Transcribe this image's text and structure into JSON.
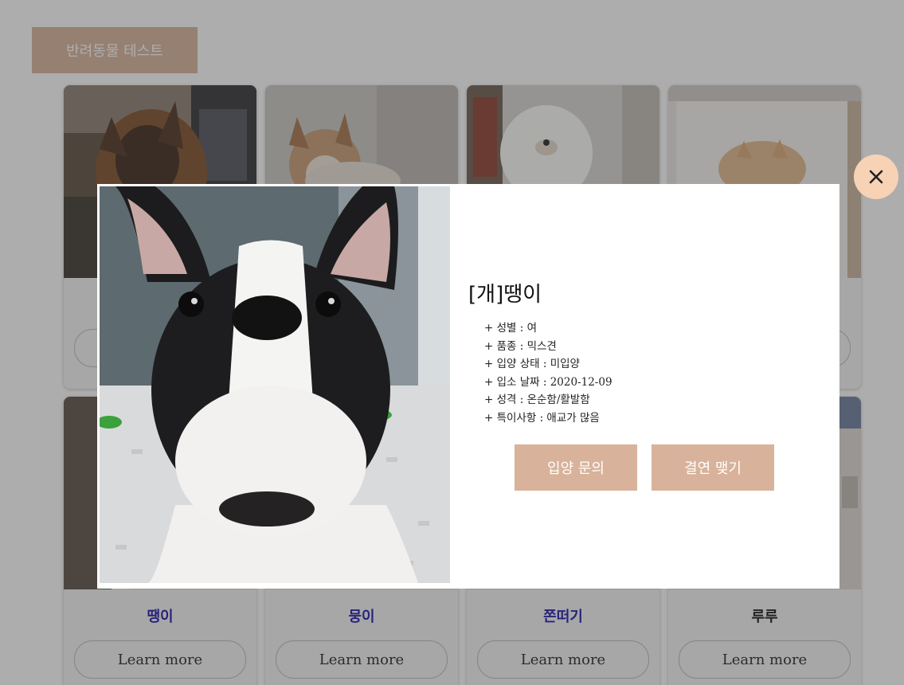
{
  "header": {
    "title_button": "반려동물 테스트"
  },
  "cards": [
    {
      "name": "땡이",
      "name_color": "#1a10a8",
      "button": "Learn more"
    },
    {
      "name": "뭉이",
      "name_color": "#1a10a8",
      "button": "Learn more"
    },
    {
      "name": "쫀떠기",
      "name_color": "#1a10a8",
      "button": "Learn more"
    },
    {
      "name": "루루",
      "name_color": "#111111",
      "button": "Learn more"
    }
  ],
  "modal": {
    "title": "[개]땡이",
    "details": [
      "+ 성별 : 여",
      "+ 품종 : 믹스견",
      "+ 입양 상태 : 미입양",
      "+ 입소 날짜 : 2020-12-09",
      "+ 성격 : 온순함/활발함",
      "+ 특이사항 : 애교가 많음"
    ],
    "buttons": {
      "adopt": "입양 문의",
      "sponsor": "결연 맺기"
    },
    "close_icon": "close-icon"
  },
  "colors": {
    "accent": "#d8b29a",
    "close_button_bg": "#f7d2b5",
    "overlay": "rgba(60,60,60,0.42)"
  }
}
